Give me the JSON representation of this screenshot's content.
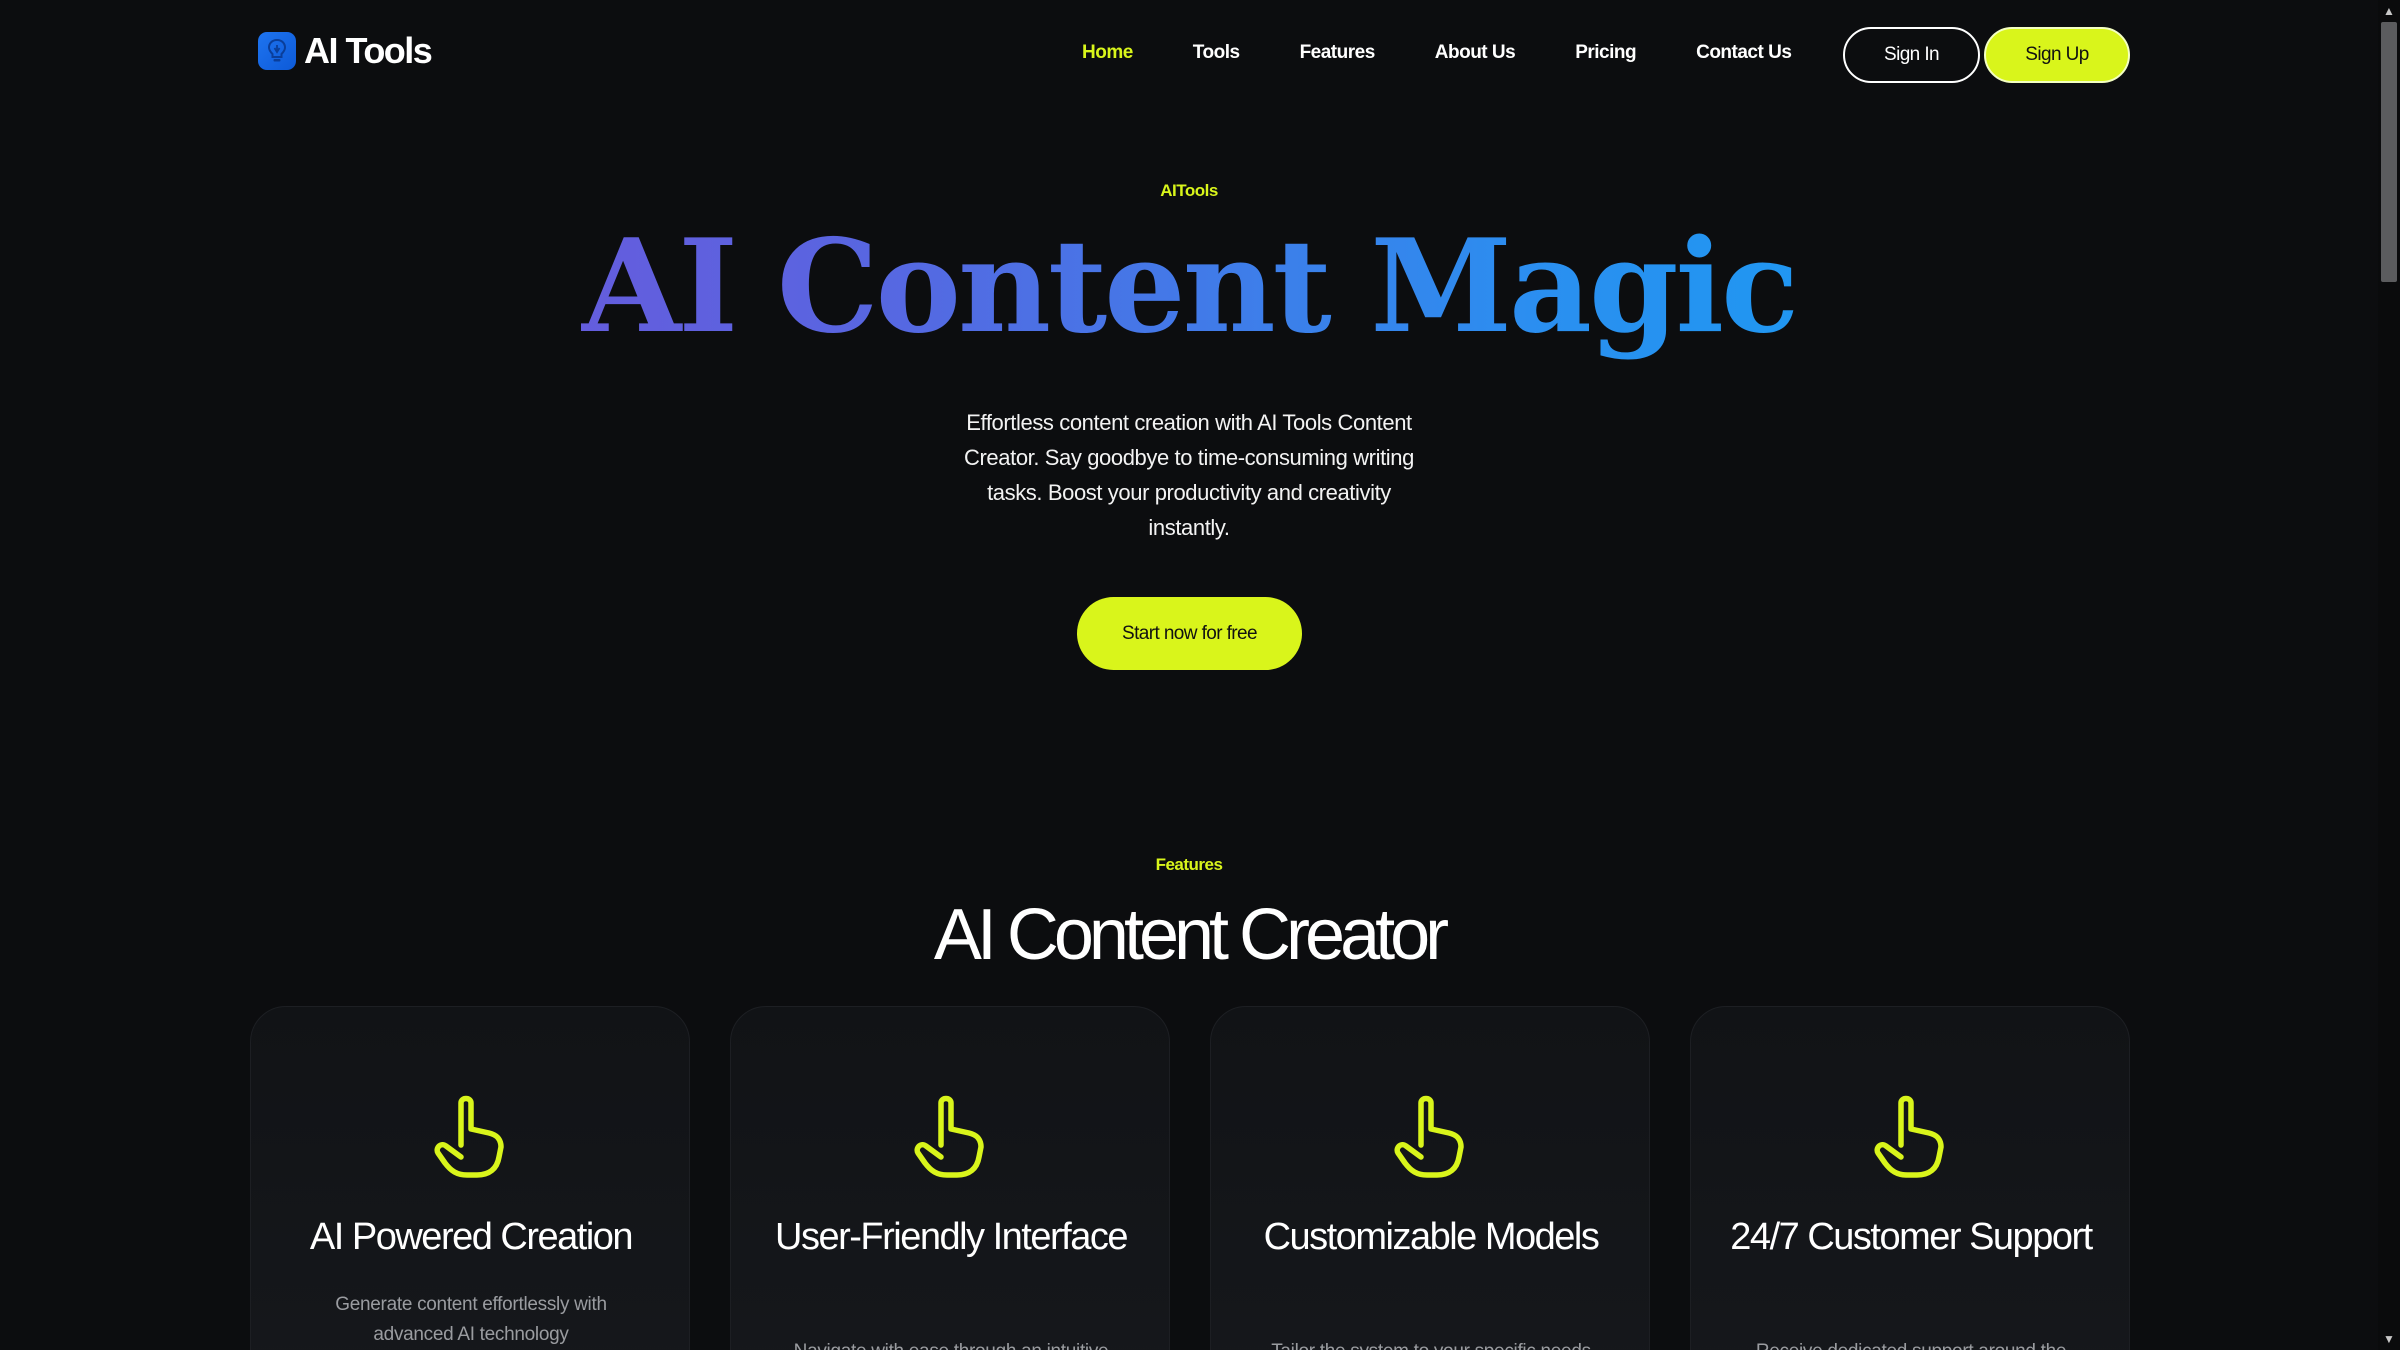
{
  "brand": {
    "name": "AI Tools",
    "icon": "bulb-icon",
    "badge_color": "#1e74f0"
  },
  "nav": {
    "items": [
      {
        "label": "Home",
        "active": true
      },
      {
        "label": "Tools",
        "active": false
      },
      {
        "label": "Features",
        "active": false
      },
      {
        "label": "About Us",
        "active": false
      },
      {
        "label": "Pricing",
        "active": false
      },
      {
        "label": "Contact Us",
        "active": false
      }
    ],
    "sign_in": "Sign In",
    "sign_up": "Sign Up"
  },
  "hero": {
    "eyebrow": "AITools",
    "title": "AI Content Magic",
    "subtitle": "Effortless content creation with AI Tools Content Creator. Say goodbye to time-consuming writing tasks. Boost your productivity and creativity instantly.",
    "cta": "Start now for free"
  },
  "features": {
    "eyebrow": "Features",
    "title": "AI Content Creator",
    "cards": [
      {
        "icon": "pointer-hand-icon",
        "title": "AI Powered Creation",
        "desc": "Generate content effortlessly with advanced AI technology"
      },
      {
        "icon": "pointer-hand-icon",
        "title": "User-Friendly Interface",
        "desc": "Navigate with ease through an intuitive"
      },
      {
        "icon": "pointer-hand-icon",
        "title": "Customizable Models",
        "desc": "Tailor the system to your specific needs"
      },
      {
        "icon": "pointer-hand-icon",
        "title": "24/7 Customer Support",
        "desc": "Receive dedicated support around the"
      }
    ]
  },
  "colors": {
    "accent": "#d9f51b",
    "background": "#0c0d0f",
    "title_gradient_start": "#7a4dd6",
    "title_gradient_end": "#0aa8f5"
  }
}
